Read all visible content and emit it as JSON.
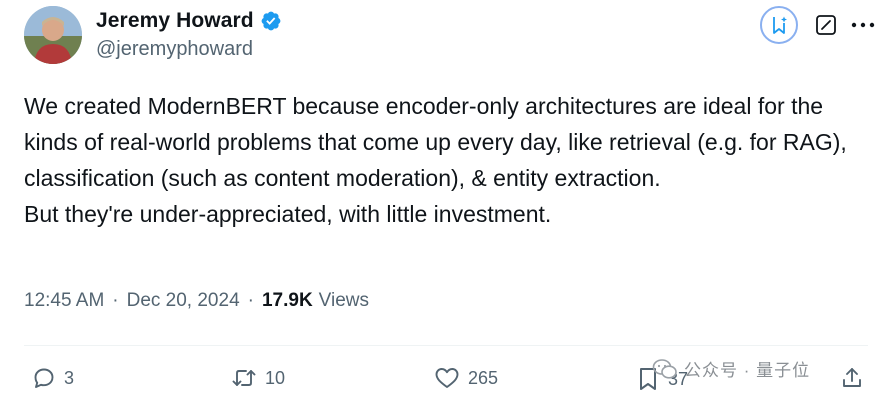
{
  "author": {
    "display_name": "Jeremy Howard",
    "handle": "@jeremyphoward",
    "verified": true
  },
  "tweet": {
    "paragraphs": [
      "We created ModernBERT because encoder-only architectures are ideal for the kinds of real-world problems that come up every day, like retrieval (e.g. for RAG), classification (such as content moderation), & entity extraction.",
      "But they're under-appreciated, with little investment."
    ],
    "time": "12:45 AM",
    "date": "Dec 20, 2024",
    "separator": "·",
    "views_count": "17.9K",
    "views_label": "Views"
  },
  "actions": {
    "replies": "3",
    "retweets": "10",
    "likes": "265",
    "bookmarks": "37"
  },
  "watermark": {
    "text": "公众号 · 量子位"
  },
  "icons": {
    "verified": "verified-badge-icon",
    "grok": "grok-icon",
    "edit": "edit-icon",
    "more": "more-icon",
    "reply": "reply-icon",
    "retweet": "retweet-icon",
    "like": "heart-icon",
    "bookmark": "bookmark-icon",
    "share": "share-icon"
  },
  "colors": {
    "verified_blue": "#1d9bf0",
    "text_primary": "#0f1419",
    "text_secondary": "#536471",
    "grok_border": "#8ab0f0"
  }
}
